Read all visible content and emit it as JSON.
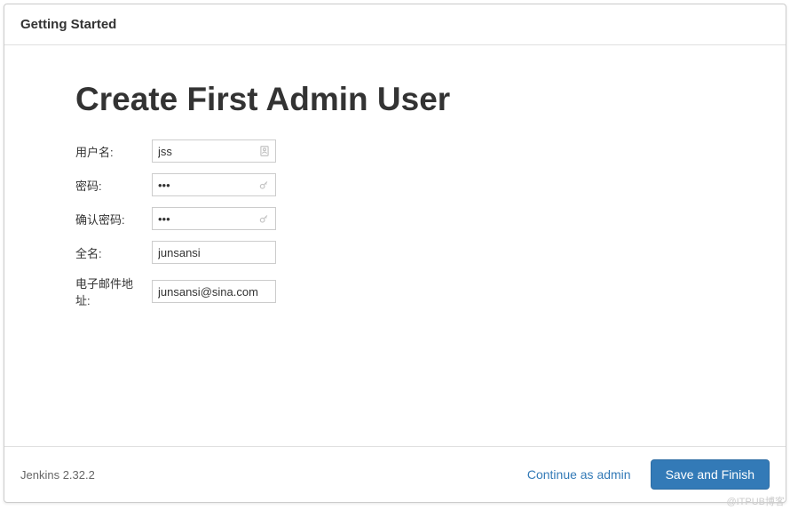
{
  "header": {
    "title": "Getting Started"
  },
  "main": {
    "title": "Create First Admin User",
    "form": {
      "username": {
        "label": "用户名:",
        "value": "jss"
      },
      "password": {
        "label": "密码:",
        "value": "•••"
      },
      "confirm_password": {
        "label": "确认密码:",
        "value": "•••"
      },
      "fullname": {
        "label": "全名:",
        "value": "junsansi"
      },
      "email": {
        "label": "电子邮件地址:",
        "value": "junsansi@sina.com"
      }
    }
  },
  "footer": {
    "version": "Jenkins 2.32.2",
    "continue_label": "Continue as admin",
    "save_label": "Save and Finish"
  },
  "watermark": "@ITPUB博客"
}
